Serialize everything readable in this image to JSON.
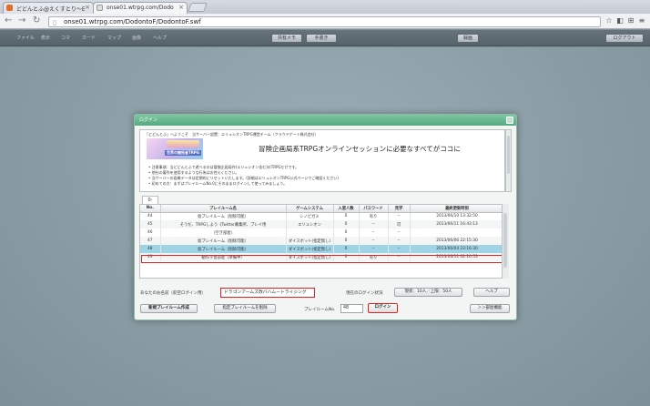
{
  "browser": {
    "tabs": [
      {
        "title": "どどんとふ@えくすとり〜E",
        "active": false,
        "close": "×"
      },
      {
        "title": "onse01.wtrpg.com/Dodo",
        "active": true,
        "close": "×"
      }
    ],
    "url": "onse01.wtrpg.com/DodontoF/DodontoF.swf",
    "nav": {
      "back": "←",
      "forward": "→",
      "reload": "↻"
    },
    "toolbar_icons": [
      "star-icon",
      "extension-icon",
      "translate-icon",
      "menu-icon"
    ]
  },
  "app": {
    "menus": [
      "ファイル",
      "表示",
      "コマ",
      "カード",
      "マップ",
      "画像",
      "ヘルプ"
    ],
    "buttons": {
      "sharedmemo": "共有メモ",
      "handout": "手書き",
      "record": "録画",
      "logout": "ログアウト"
    }
  },
  "dialog": {
    "title": "ログイン",
    "notice": {
      "welcome": "「どどんとふ」へようこそ　当サーバー設置：エリュシオンTRPG運営チーム（クラウドゲート株式会社）",
      "banner_text": "世界の開拓者TRPG",
      "headline": "冒険企画局系TRPGオンラインセッションに必要なすべてがココに",
      "bullets": [
        "注意事項：当どどんとふで遊べるのは冒険企画局作(エリュシオン含む)のTRPGだけです。",
        "他社の著作を使用するような行為はお控えください。",
        "当サーバーの画像データは定期的にリセットいたします。(詳細はエリュシオンTRPG公式ページでご確認ください)",
        "初めての方：まずはプレイルームNo.0にそのままログインして使ってみましょう。"
      ]
    },
    "lobby_tab": "0-",
    "table": {
      "headers": [
        "No.",
        "プレイルーム名",
        "ゲームシステム",
        "入室人数",
        "パスワード",
        "見学",
        "最終更新時刻"
      ],
      "rows": [
        {
          "no": "44",
          "name": "仮プレイルーム（削除可能）",
          "system": "シノビガミ",
          "count": "0",
          "password": "有り",
          "visit": "--",
          "updated": "2013/06/10 13:32:50"
        },
        {
          "no": "45",
          "name": "そうだ、TRPGしよう《Twitter募集所、プレイ用",
          "system": "エリュシオン",
          "count": "0",
          "password": "--",
          "visit": "可",
          "updated": "2013/06/11 16:43:13"
        },
        {
          "no": "46",
          "name": "（空き部屋）",
          "system": "",
          "count": "0",
          "password": "--",
          "visit": "--",
          "updated": ""
        },
        {
          "no": "47",
          "name": "仮プレイルーム（削除可能）",
          "system": "ダイスボット(指定無し)",
          "count": "0",
          "password": "--",
          "visit": "--",
          "updated": "2013/06/06 22:15:30"
        },
        {
          "no": "48",
          "name": "仮プレイルーム（削除可能）",
          "system": "ダイスボット(指定無し)",
          "count": "0",
          "password": "--",
          "visit": "--",
          "updated": "2013/06/04 23:16:30"
        },
        {
          "no": "49",
          "name": "動作学習部屋（準備中）",
          "system": "ダイスボット(指定無し)",
          "count": "0",
          "password": "有り",
          "visit": "--",
          "updated": "2013/06/11 02:10:53"
        }
      ],
      "selected_row": 4
    },
    "form": {
      "name_label": "あなたのお名前（航空ログイン用）",
      "name_value": "ドラゴンアームズ改バハムートライジング",
      "status_label": "現在のログイン状況",
      "status_value": "現状：10人／上限：50人",
      "help": "ヘルプ",
      "create": "新規プレイルーム作成",
      "delete": "指定プレイルームを削除",
      "room_label": "プレイルームNo.",
      "room_value": "48",
      "login": "ログイン",
      "all_rooms": "＞＞部屋機能"
    }
  },
  "colors": {
    "dialog_title": "#55a982",
    "selected_row": "#9fd4e6",
    "highlight": "#e02020"
  }
}
